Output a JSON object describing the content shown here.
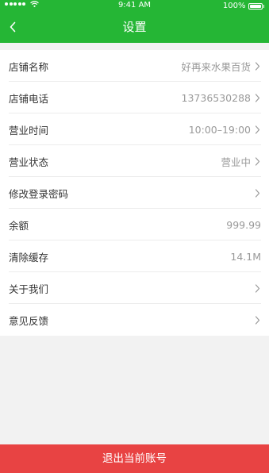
{
  "status_bar": {
    "time": "9:41 AM",
    "battery": "100%"
  },
  "header": {
    "title": "设置"
  },
  "settings": [
    {
      "label": "店铺名称",
      "value": "好再来水果百货",
      "has_arrow": true
    },
    {
      "label": "店铺电话",
      "value": "13736530288",
      "has_arrow": true
    },
    {
      "label": "营业时间",
      "value": "10:00–19:00",
      "has_arrow": true
    },
    {
      "label": "营业状态",
      "value": "营业中",
      "has_arrow": true
    },
    {
      "label": "修改登录密码",
      "value": "",
      "has_arrow": true
    },
    {
      "label": "余额",
      "value": "999.99",
      "has_arrow": false
    },
    {
      "label": "清除缓存",
      "value": "14.1M",
      "has_arrow": false
    },
    {
      "label": "关于我们",
      "value": "",
      "has_arrow": true
    },
    {
      "label": "意见反馈",
      "value": "",
      "has_arrow": true
    }
  ],
  "logout": {
    "label": "退出当前账号"
  },
  "colors": {
    "brand_green": "#25b635",
    "logout_red": "#e84343"
  }
}
